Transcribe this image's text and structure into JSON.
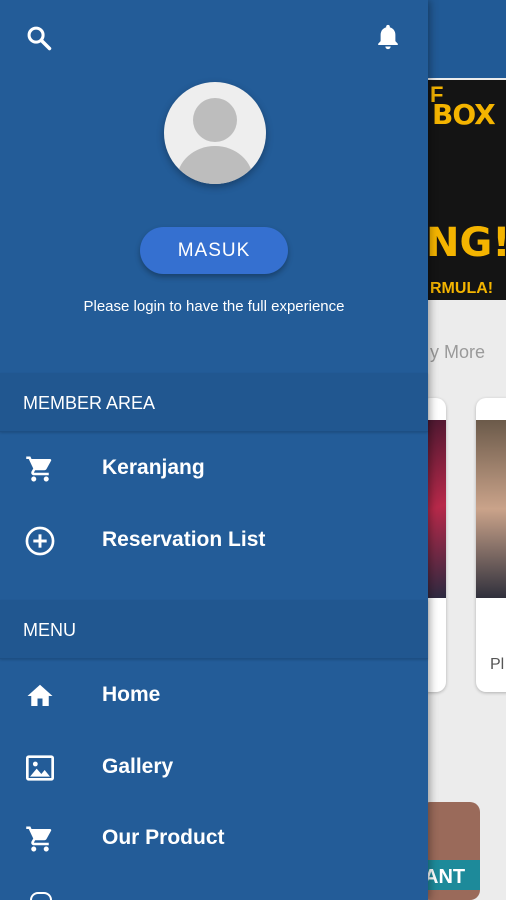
{
  "background": {
    "banner_lines": [
      "F",
      "BOX",
      "NG!",
      "RMULA!"
    ],
    "view_more": "y More",
    "card_label": "Pl",
    "bottom_card_text": "ANT"
  },
  "drawer": {
    "icons": {
      "search": "search-icon",
      "notifications": "bell-icon",
      "avatar": "user-placeholder-avatar"
    },
    "login_button": "MASUK",
    "login_note": "Please login to have the full experience",
    "member_area": {
      "title": "MEMBER AREA",
      "items": [
        {
          "label": "Keranjang",
          "icon": "cart-icon"
        },
        {
          "label": "Reservation List",
          "icon": "add-circle-icon"
        }
      ]
    },
    "menu": {
      "title": "MENU",
      "items": [
        {
          "label": "Home",
          "icon": "home-icon"
        },
        {
          "label": "Gallery",
          "icon": "image-icon"
        },
        {
          "label": "Our Product",
          "icon": "cart-icon"
        }
      ]
    }
  },
  "colors": {
    "drawer": "#235c98",
    "section_header": "#215790",
    "login_button": "#3570d0",
    "text": "#ffffff"
  }
}
